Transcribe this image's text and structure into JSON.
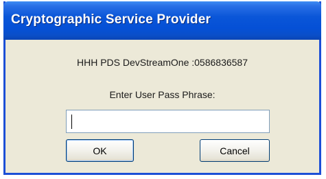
{
  "dialog": {
    "title": "Cryptographic Service Provider",
    "provider_label": "HHH PDS DevStreamOne :0586836587",
    "prompt_label": "Enter User Pass Phrase:",
    "passphrase": {
      "value": "",
      "placeholder": ""
    },
    "ok_label": "OK",
    "cancel_label": "Cancel"
  },
  "colors": {
    "titlebar": "#0550d6",
    "frame_border": "#1c4fd6",
    "dialog_background": "#ece9d8",
    "button_border": "#003c74"
  }
}
